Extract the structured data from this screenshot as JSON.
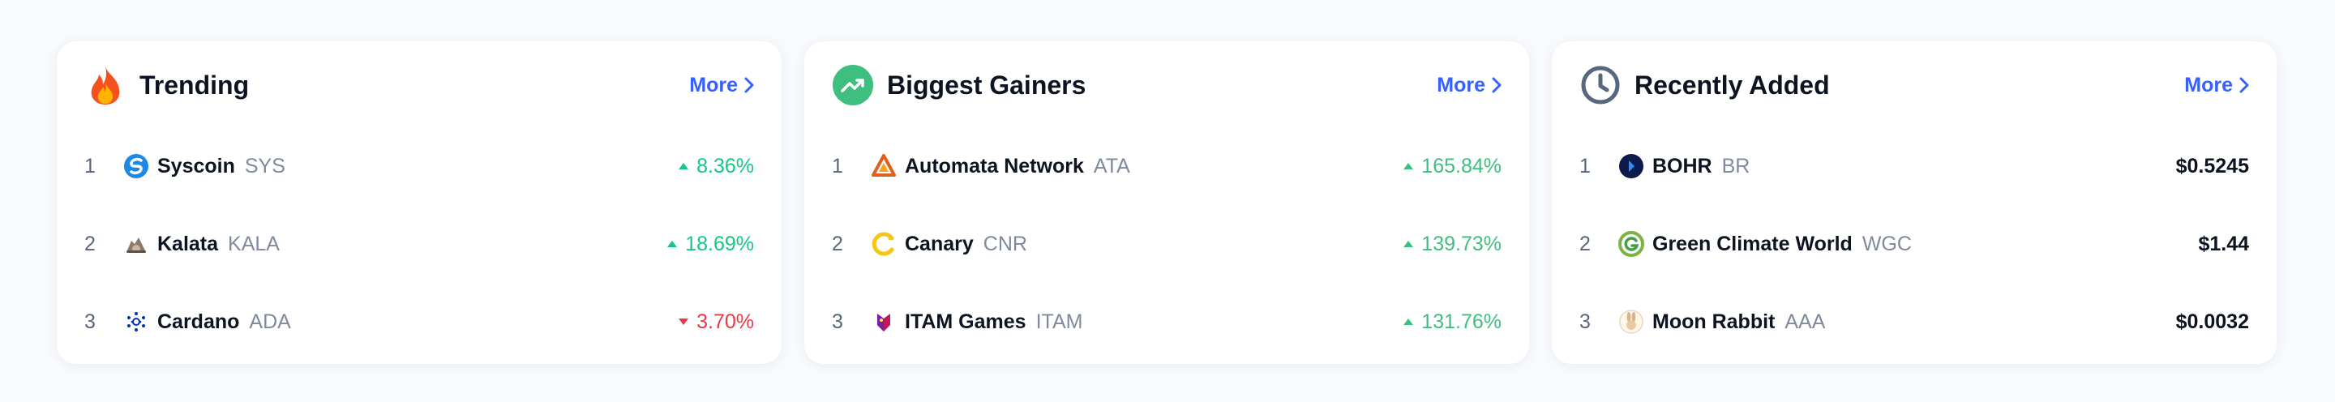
{
  "colors": {
    "accent": "#3861fb",
    "positive": "#16c784",
    "negative": "#ea3943",
    "muted": "#808a9d"
  },
  "more_label": "More",
  "cards": [
    {
      "title": "Trending",
      "icon": "fire-icon",
      "rows": [
        {
          "rank": "1",
          "name": "Syscoin",
          "symbol": "SYS",
          "value": "8.36%",
          "direction": "up",
          "icon": "syscoin-logo-icon"
        },
        {
          "rank": "2",
          "name": "Kalata",
          "symbol": "KALA",
          "value": "18.69%",
          "direction": "up",
          "icon": "kalata-logo-icon"
        },
        {
          "rank": "3",
          "name": "Cardano",
          "symbol": "ADA",
          "value": "3.70%",
          "direction": "down",
          "icon": "cardano-logo-icon"
        }
      ]
    },
    {
      "title": "Biggest Gainers",
      "icon": "trending-up-icon",
      "rows": [
        {
          "rank": "1",
          "name": "Automata Network",
          "symbol": "ATA",
          "value": "165.84%",
          "direction": "up",
          "icon": "automata-logo-icon"
        },
        {
          "rank": "2",
          "name": "Canary",
          "symbol": "CNR",
          "value": "139.73%",
          "direction": "up",
          "icon": "canary-logo-icon"
        },
        {
          "rank": "3",
          "name": "ITAM Games",
          "symbol": "ITAM",
          "value": "131.76%",
          "direction": "up",
          "icon": "itam-logo-icon"
        }
      ]
    },
    {
      "title": "Recently Added",
      "icon": "clock-icon",
      "rows": [
        {
          "rank": "1",
          "name": "BOHR",
          "symbol": "BR",
          "value": "$0.5245",
          "direction": "price",
          "icon": "bohr-logo-icon"
        },
        {
          "rank": "2",
          "name": "Green Climate World",
          "symbol": "WGC",
          "value": "$1.44",
          "direction": "price",
          "icon": "green-climate-world-logo-icon"
        },
        {
          "rank": "3",
          "name": "Moon Rabbit",
          "symbol": "AAA",
          "value": "$0.0032",
          "direction": "price",
          "icon": "moon-rabbit-logo-icon"
        }
      ]
    }
  ]
}
